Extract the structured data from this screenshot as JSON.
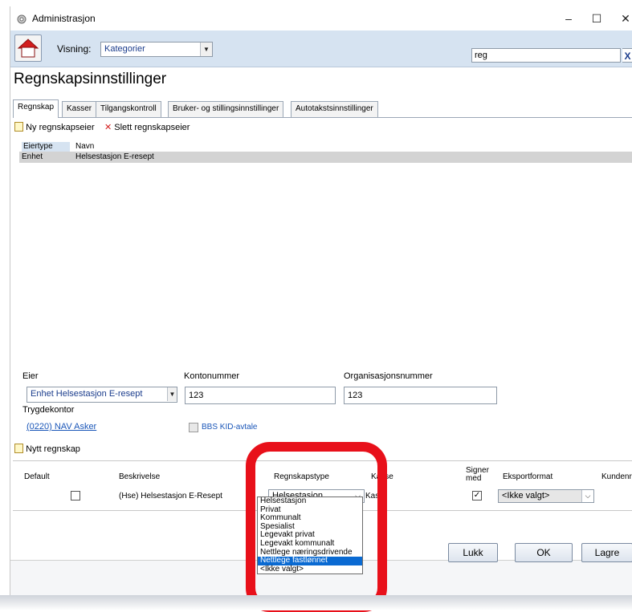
{
  "window": {
    "title": "Administrasjon",
    "controls": [
      "–",
      "☐",
      "✕"
    ]
  },
  "toolbar": {
    "visning_label": "Visning:",
    "visning_value": "Kategorier",
    "search_value": "reg",
    "search_clear": "X"
  },
  "page_title": "Regnskapsinnstillinger",
  "tabs": [
    "Regnskap",
    "Kasser",
    "Tilgangskontroll",
    "Bruker- og stillingsinnstillinger",
    "Autotakstsinnstillinger"
  ],
  "commands": {
    "new_owner": "Ny regnskapseier",
    "delete_owner": "Slett regnskapseier"
  },
  "owners_grid": {
    "columns": [
      "Eiertype",
      "Navn"
    ],
    "rows": [
      [
        "Enhet",
        "Helsestasjon E-resept"
      ]
    ]
  },
  "owner_form": {
    "eier_label": "Eier",
    "eier_value": "Enhet Helsestasjon E-resept",
    "kontonummer_label": "Kontonummer",
    "kontonummer_value": "123",
    "orgnr_label": "Organisasjonsnummer",
    "orgnr_value": "123",
    "trygdekontor_label": "Trygdekontor",
    "trygdekontor_value": "(0220) NAV Asker",
    "bbs_label": "BBS KID-avtale"
  },
  "accounts": {
    "new_label": "Nytt regnskap",
    "columns": {
      "default": "Default",
      "beskrivelse": "Beskrivelse",
      "regnskapstype": "Regnskapstype",
      "kasse": "Kasse",
      "signer": "Signer\nmed",
      "eksportformat": "Eksportformat",
      "kundenr": "Kundenr"
    },
    "row": {
      "beskrivelse": "(Hse) Helsestasjon E-Resept",
      "regnskapstype": "Helsestasjon",
      "kasse": "Kas",
      "eksportformat": "<Ikke valgt>"
    },
    "type_options": [
      "Helsestasjon",
      "Privat",
      "Kommunalt",
      "Spesialist",
      "Legevakt privat",
      "Legevakt kommunalt",
      "Nettlege næringsdrivende",
      "Nettlege fastlønnet",
      "<Ikke valgt>"
    ],
    "type_highlighted": "Nettlege fastlønnet"
  },
  "buttons": {
    "lukk": "Lukk",
    "ok": "OK",
    "lagre": "Lagre"
  },
  "colors": {
    "toolbar_bg": "#d6e3f1",
    "selection": "#0a6ad2",
    "annotation_ring": "#e8101a",
    "link": "#1a56b8"
  }
}
